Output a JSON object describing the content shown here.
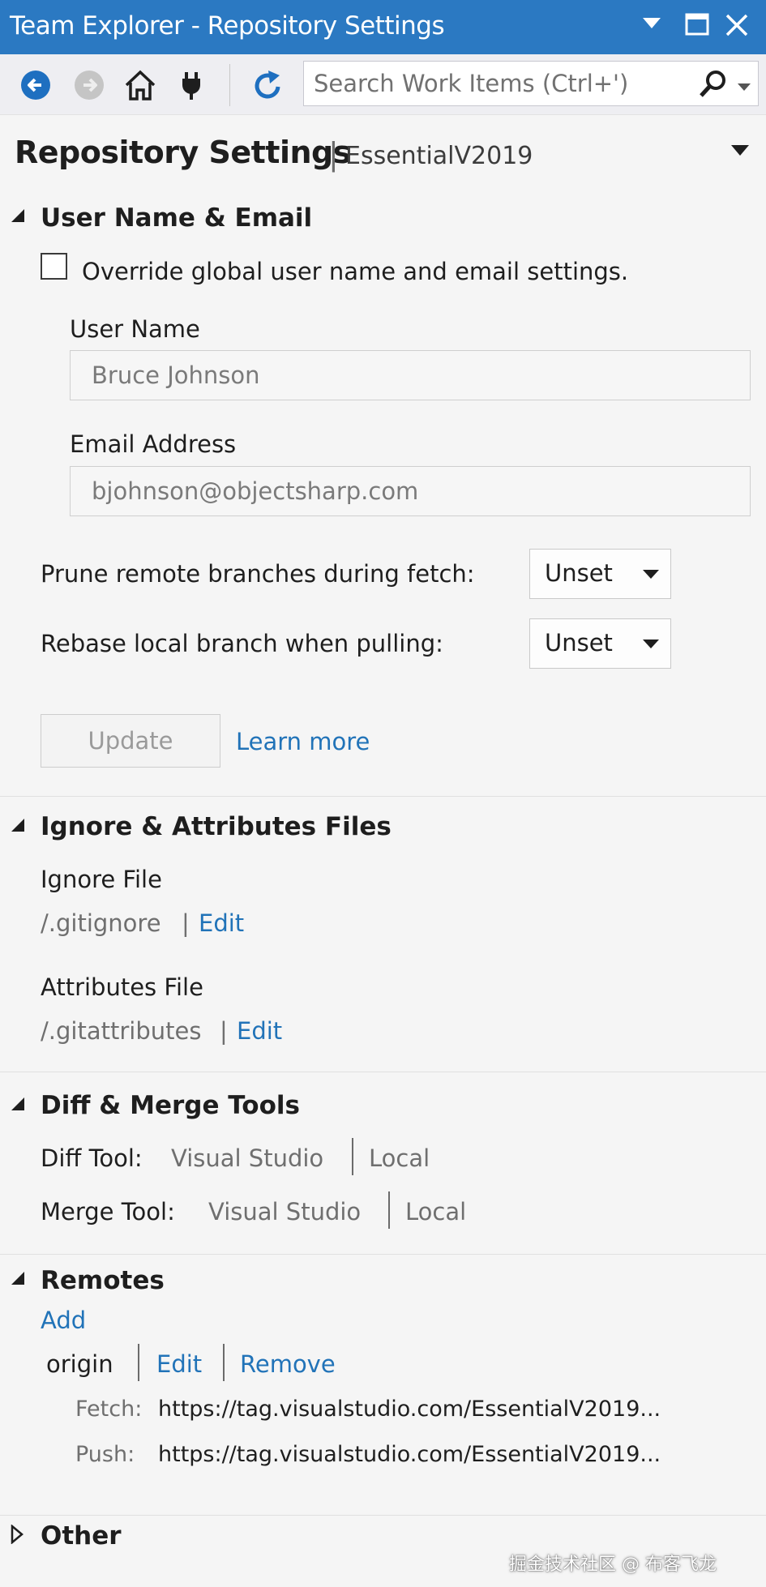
{
  "window": {
    "title": "Team Explorer - Repository Settings"
  },
  "toolbar": {
    "buttons": [
      "back-icon",
      "forward-icon",
      "home-icon",
      "connect-icon",
      "refresh-icon"
    ],
    "search_placeholder": "Search Work Items (Ctrl+')"
  },
  "header": {
    "title": "Repository Settings",
    "separator": "|",
    "repo": "EssentialV2019"
  },
  "user_section": {
    "heading": "User Name & Email",
    "override_label": "Override global user name and email settings.",
    "override_checked": false,
    "user_name_label": "User Name",
    "user_name_value": "Bruce Johnson",
    "email_label": "Email Address",
    "email_value": "bjohnson@objectsharp.com",
    "prune_label": "Prune remote branches during fetch:",
    "prune_value": "Unset",
    "rebase_label": "Rebase local branch when pulling:",
    "rebase_value": "Unset",
    "update_label": "Update",
    "learn_more_label": "Learn more"
  },
  "files_section": {
    "heading": "Ignore & Attributes Files",
    "ignore_label": "Ignore File",
    "ignore_path": "/.gitignore",
    "ignore_edit": "Edit",
    "attributes_label": "Attributes File",
    "attributes_path": "/.gitattributes",
    "attributes_edit": "Edit",
    "sep": "|"
  },
  "tools_section": {
    "heading": "Diff & Merge Tools",
    "diff_label": "Diff Tool:",
    "diff_value": "Visual Studio",
    "diff_scope": "Local",
    "merge_label": "Merge Tool:",
    "merge_value": "Visual Studio",
    "merge_scope": "Local"
  },
  "remotes_section": {
    "heading": "Remotes",
    "add_label": "Add",
    "remote_name": "origin",
    "edit_label": "Edit",
    "remove_label": "Remove",
    "fetch_label": "Fetch:",
    "fetch_url": "https://tag.visualstudio.com/EssentialV2019...",
    "push_label": "Push:",
    "push_url": "https://tag.visualstudio.com/EssentialV2019..."
  },
  "other_section": {
    "heading": "Other"
  },
  "watermark": "掘金技术社区 @ 布客飞龙"
}
